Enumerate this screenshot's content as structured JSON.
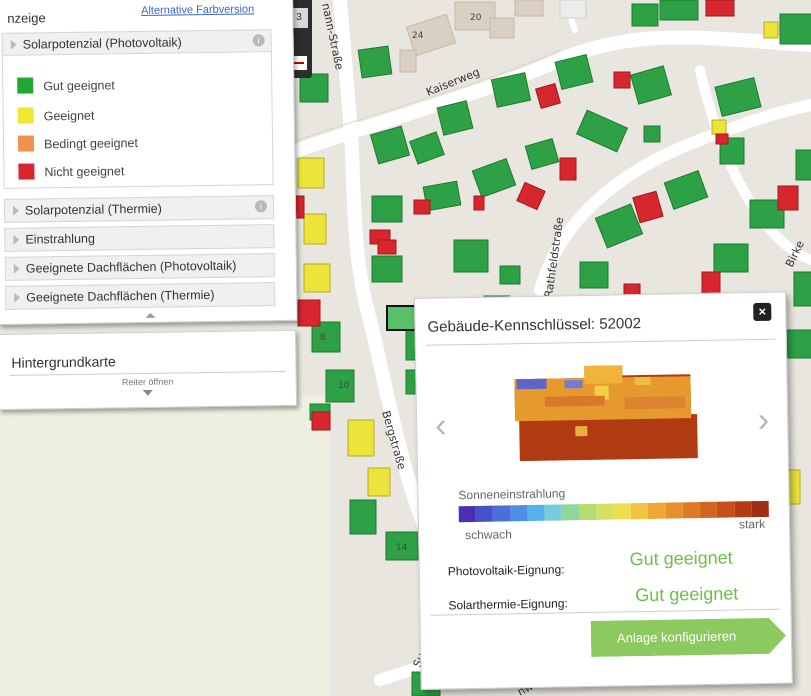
{
  "legend": {
    "header_partial": "nzeige",
    "alt_color_link": "Alternative Farbversion",
    "sections": [
      {
        "label": "Solarpotenzial (Photovoltaik)",
        "expanded": true
      },
      {
        "label": "Solarpotenzial (Thermie)",
        "expanded": false
      },
      {
        "label": "Einstrahlung",
        "expanded": false
      },
      {
        "label": "Geeignete Dachflächen (Photovoltaik)",
        "expanded": false
      },
      {
        "label": "Geeignete Dachflächen (Thermie)",
        "expanded": false
      }
    ],
    "items": [
      {
        "label": "Gut geeignet",
        "color": "#1fa833"
      },
      {
        "label": "Geeignet",
        "color": "#efe830"
      },
      {
        "label": "Bedingt geeignet",
        "color": "#f3914e"
      },
      {
        "label": "Nicht geeignet",
        "color": "#d8262e"
      }
    ]
  },
  "background_panel": {
    "title": "Hintergrundkarte",
    "open_tabs": "Reiter öffnen"
  },
  "zoom": {
    "level": "3"
  },
  "streets": [
    "Kaiserweg",
    "Rathfeldstraße",
    "Bergstraße",
    "nann-Straße",
    "Birke",
    "Sun",
    "nweg"
  ],
  "house_numbers": [
    "24",
    "20",
    "10",
    "8",
    "14"
  ],
  "popup": {
    "title": "Gebäude-Kennschlüssel: 52002",
    "scale_title": "Sonneneinstrahlung",
    "scale_low": "schwach",
    "scale_high": "stark",
    "pv_label": "Photovoltaik-Eignung:",
    "pv_value": "Gut geeignet",
    "st_label": "Solarthermie-Eignung:",
    "st_value": "Gut geeignet",
    "cta_label": "Anlage konfigurieren",
    "scale_colors": [
      "#4a2fb2",
      "#4852c6",
      "#4b6fd8",
      "#4b8ee4",
      "#53b3e6",
      "#74cdd8",
      "#92d79a",
      "#b7dc73",
      "#d6e15f",
      "#efde4f",
      "#f1c43f",
      "#eca734",
      "#e6902d",
      "#de7a27",
      "#d26422",
      "#c5501c",
      "#b33c16",
      "#a12d12"
    ]
  }
}
